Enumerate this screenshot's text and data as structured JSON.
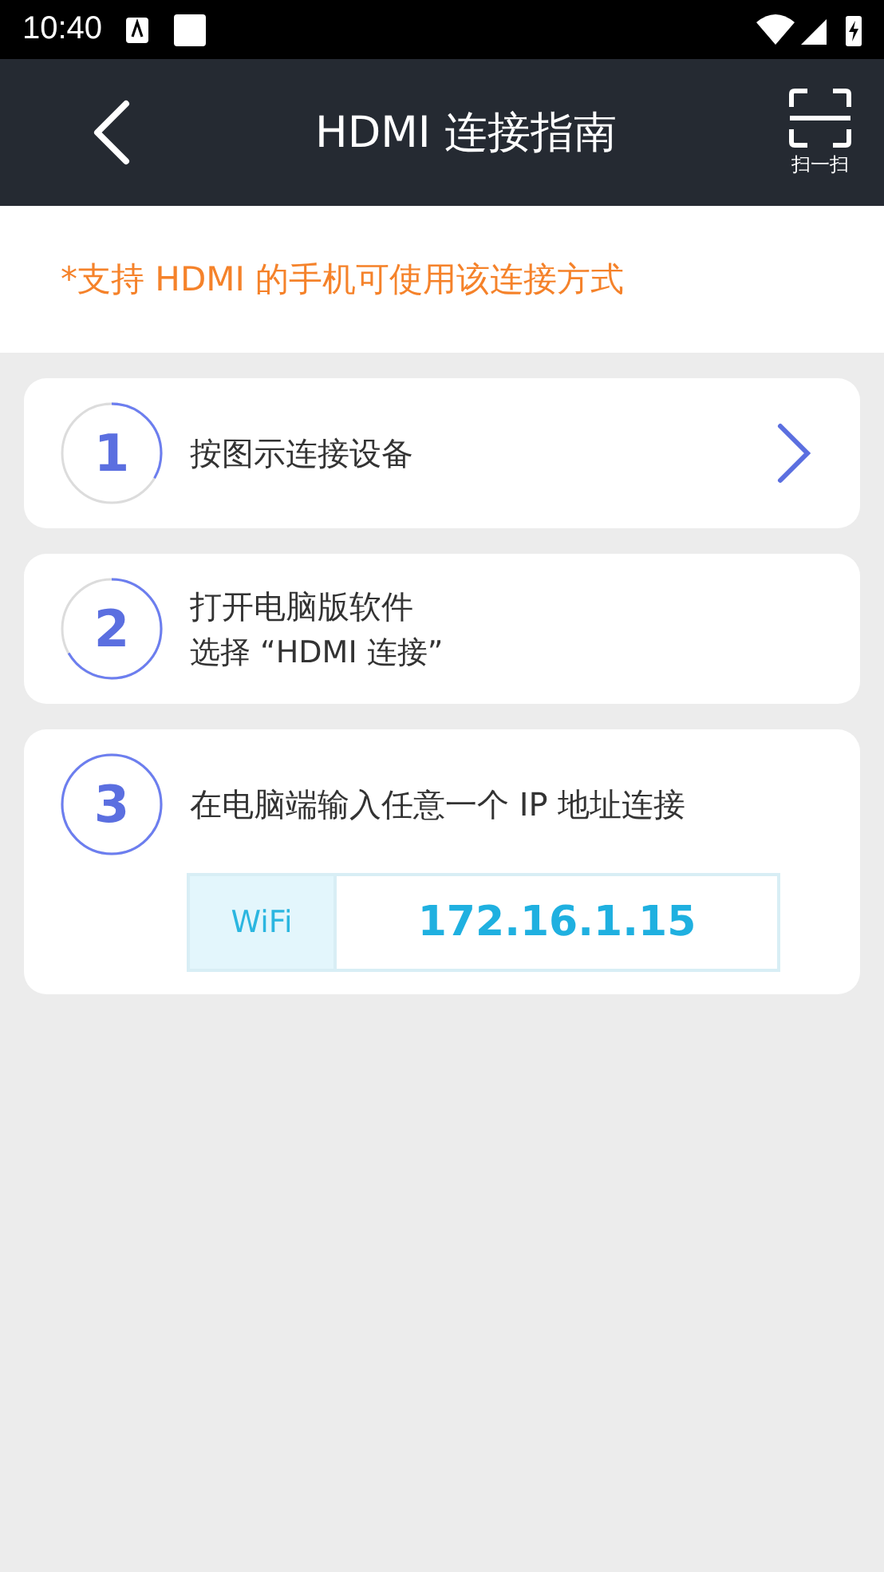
{
  "status_bar": {
    "time": "10:40"
  },
  "header": {
    "title": "HDMI 连接指南",
    "scan_label": "扫一扫"
  },
  "notice": "*支持 HDMI 的手机可使用该连接方式",
  "steps": [
    {
      "kind": "link",
      "number": "1",
      "title": "按图示连接设备"
    },
    {
      "kind": "text",
      "number": "2",
      "title": "打开电脑版软件",
      "subtitle": "选择 “HDMI 连接”"
    },
    {
      "kind": "address",
      "number": "3",
      "title": "在电脑端输入任意一个 IP 地址连接",
      "addresses": [
        {
          "network": "WiFi",
          "ip": "172.16.1.15"
        }
      ]
    }
  ]
}
